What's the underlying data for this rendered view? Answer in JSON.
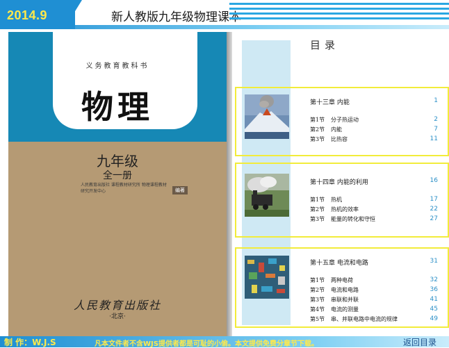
{
  "header": {
    "date": "2014.9",
    "title": "新人教版九年级物理课本"
  },
  "cover": {
    "series": "义务教育教科书",
    "title": "物理",
    "grade": "九年级",
    "volume": "全一册",
    "editors": "人民教育出版社  课程教材研究所 物理课程教材研究开发中心",
    "editor_tag": "编著",
    "publisher": "人民教育出版社",
    "city": "·北京·",
    "colors": {
      "top": "#1688b5",
      "bottom": "#b59a74"
    }
  },
  "toc": {
    "heading": "目录",
    "chapters": [
      {
        "title": "第十三章  内能",
        "page": "1",
        "image": "volcano-image",
        "sections": [
          {
            "num": "第1节",
            "title": "分子热运动",
            "page": "2"
          },
          {
            "num": "第2节",
            "title": "内能",
            "page": "7"
          },
          {
            "num": "第3节",
            "title": "比热容",
            "page": "11"
          }
        ]
      },
      {
        "title": "第十四章  内能的利用",
        "page": "16",
        "image": "steam-train-image",
        "sections": [
          {
            "num": "第1节",
            "title": "热机",
            "page": "17"
          },
          {
            "num": "第2节",
            "title": "热机的效率",
            "page": "22"
          },
          {
            "num": "第3节",
            "title": "能量的转化和守恒",
            "page": "27"
          }
        ]
      },
      {
        "title": "第十五章  电流和电路",
        "page": "31",
        "image": "circuit-board-image",
        "sections": [
          {
            "num": "第1节",
            "title": "两种电荷",
            "page": "32"
          },
          {
            "num": "第2节",
            "title": "电流和电路",
            "page": "36"
          },
          {
            "num": "第3节",
            "title": "串联和并联",
            "page": "41"
          },
          {
            "num": "第4节",
            "title": "电流的测量",
            "page": "45"
          },
          {
            "num": "第5节",
            "title": "串、并联电路中电流的规律",
            "page": "49"
          }
        ]
      }
    ]
  },
  "footer": {
    "author": "制 作：W.J.S",
    "note": "凡本文件者不含WJS提供者都是可耻的小偷。本文提供免费分章节下载。",
    "back_link": "返回目录"
  }
}
